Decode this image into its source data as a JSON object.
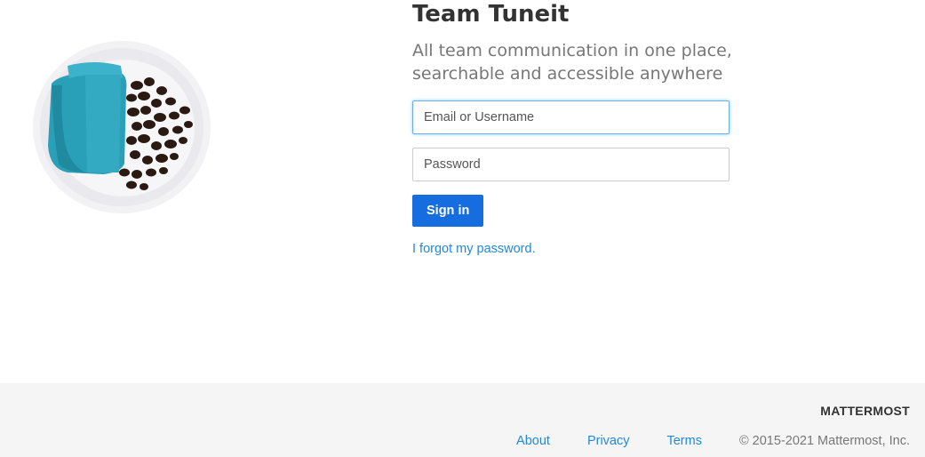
{
  "login": {
    "site_name": "Team Tuneit",
    "description": "All team communication in one place, searchable and accessible anywhere",
    "email_placeholder": "Email or Username",
    "email_value": "",
    "password_placeholder": "Password",
    "password_value": "",
    "signin_label": "Sign in",
    "forgot_label": "I forgot my password."
  },
  "illustration": {
    "name": "coffee-cup-beans-illustration",
    "colors": {
      "cup": "#2aa0b8",
      "beans": "#2a1a12",
      "plate": "#eeeeee"
    }
  },
  "footer": {
    "brand": "MATTERMOST",
    "links": [
      "About",
      "Privacy",
      "Terms"
    ],
    "copyright": "© 2015-2021 Mattermost, Inc."
  },
  "colors": {
    "accent": "#166de0",
    "link": "#2389d7",
    "footer_bg": "#f5f5f5"
  }
}
